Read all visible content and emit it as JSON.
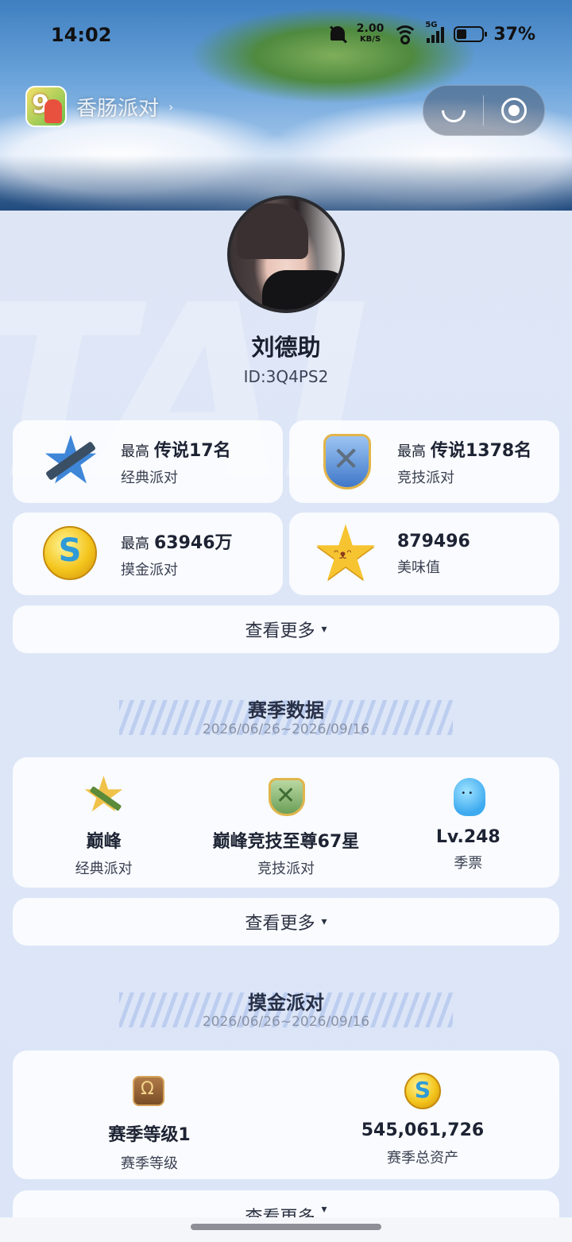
{
  "status_bar": {
    "time": "14:02",
    "net_speed": "2.00",
    "net_unit": "KB/S",
    "signal_label": "5G",
    "battery": "37%"
  },
  "app_bar": {
    "name": "香肠派对",
    "chevron": "›"
  },
  "profile": {
    "name": "刘德助",
    "id": "ID:3Q4PS2"
  },
  "top_stats": [
    {
      "prefix": "最高",
      "value": "传说17名",
      "label": "经典派对",
      "icon": "classic-star-badge"
    },
    {
      "prefix": "最高",
      "value": "传说1378名",
      "label": "竞技派对",
      "icon": "competitive-shield-badge"
    },
    {
      "prefix": "最高",
      "value": "63946万",
      "label": "摸金派对",
      "icon": "gold-coin"
    },
    {
      "prefix": "",
      "value": "879496",
      "label": "美味值",
      "icon": "smiley-star"
    }
  ],
  "more_label": "查看更多",
  "more_arrow": "▾",
  "season": {
    "title": "赛季数据",
    "date_range": "2026/06/26~2026/09/16",
    "items": [
      {
        "value": "巅峰",
        "label": "经典派对"
      },
      {
        "value": "巅峰竞技至尊67星",
        "label": "竞技派对"
      },
      {
        "value": "Lv.248",
        "label": "季票"
      }
    ]
  },
  "gold": {
    "title": "摸金派对",
    "date_range": "2026/06/26~2026/09/16",
    "items": [
      {
        "value": "赛季等级1",
        "label": "赛季等级"
      },
      {
        "value": "545,061,726",
        "label": "赛季总资产"
      }
    ]
  }
}
